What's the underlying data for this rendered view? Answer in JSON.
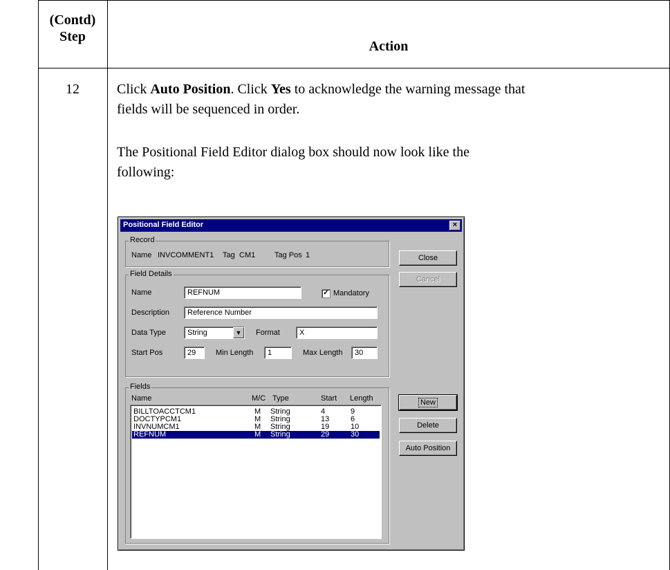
{
  "header": {
    "step_line1": "(Contd)",
    "step_line2": "Step",
    "action": "Action"
  },
  "step_number": "12",
  "instruction": {
    "t1": "Click ",
    "b1": "Auto Position",
    "t2": ". Click ",
    "b2": "Yes",
    "t3": " to acknowledge the warning message that",
    "line2": "fields will be sequenced in order."
  },
  "description": {
    "line1": "The Positional Field Editor dialog box should now look like the",
    "line2": "following:"
  },
  "dialog": {
    "title": "Positional Field Editor",
    "close_glyph": "×",
    "record": {
      "label": "Record",
      "name_label": "Name",
      "name_value": "INVCOMMENT1",
      "tag_label": "Tag",
      "tag_value": "CM1",
      "tagpos_label": "Tag Pos",
      "tagpos_value": "1"
    },
    "field_details": {
      "label": "Field Details",
      "name_label": "Name",
      "name_value": "REFNUM",
      "mandatory_label": "Mandatory",
      "mandatory_check": "✓",
      "description_label": "Description",
      "description_value": "Reference Number",
      "datatype_label": "Data Type",
      "datatype_value": "String",
      "dropdown_glyph": "▼",
      "format_label": "Format",
      "format_value": "X",
      "startpos_label": "Start Pos",
      "startpos_value": "29",
      "minlength_label": "Min Length",
      "minlength_value": "1",
      "maxlength_label": "Max Length",
      "maxlength_value": "30"
    },
    "fields": {
      "label": "Fields",
      "columns": {
        "name": "Name",
        "mc": "M/C",
        "type": "Type",
        "start": "Start",
        "length": "Length"
      },
      "rows": [
        {
          "name": "BILLTOACCTCM1",
          "mc": "M",
          "type": "String",
          "start": "4",
          "length": "9"
        },
        {
          "name": "DOCTYPCM1",
          "mc": "M",
          "type": "String",
          "start": "13",
          "length": "6"
        },
        {
          "name": "INVNUMCM1",
          "mc": "M",
          "type": "String",
          "start": "19",
          "length": "10"
        },
        {
          "name": "REFNUM",
          "mc": "M",
          "type": "String",
          "start": "29",
          "length": "30"
        }
      ]
    },
    "buttons": {
      "close": "Close",
      "cancel": "Cancel",
      "new": "New",
      "delete": "Delete",
      "auto_position": "Auto Position"
    }
  }
}
